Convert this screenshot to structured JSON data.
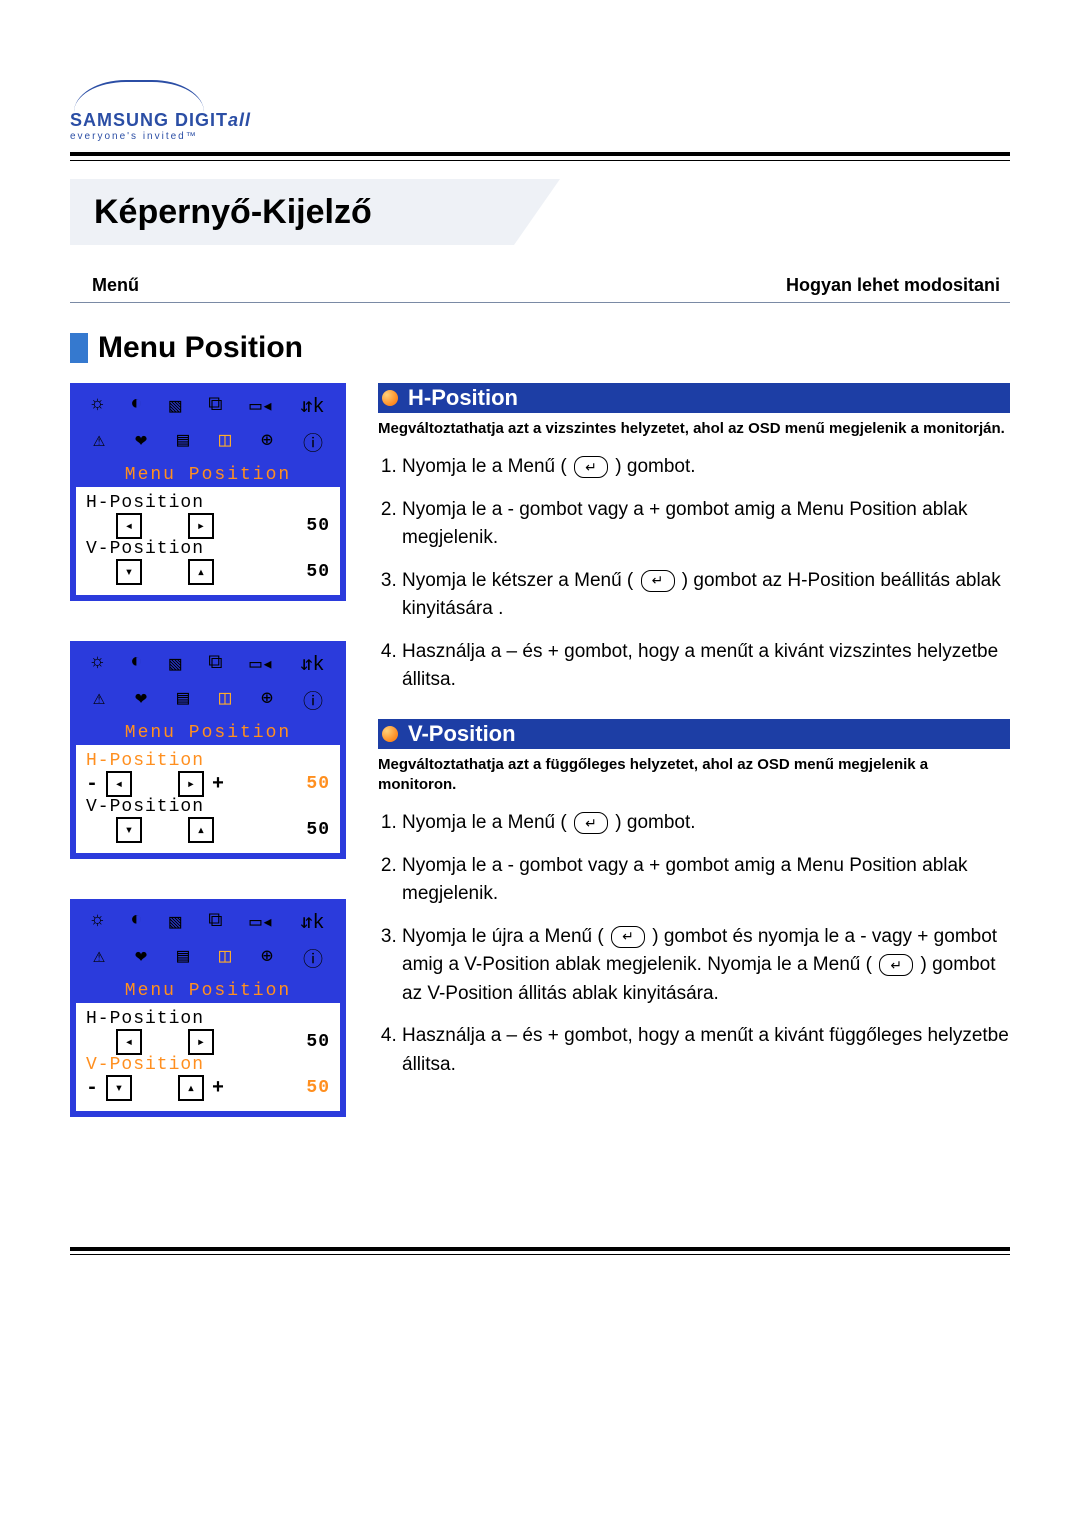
{
  "brand": {
    "main": "SAMSUNG DIGIT",
    "ital": "all",
    "tag": "everyone's invited™"
  },
  "page_title": "Képernyő-Kijelző",
  "subnav": {
    "left": "Menű",
    "right": "Hogyan lehet modositani"
  },
  "section_title": "Menu Position",
  "osd": {
    "title": "Menu Position",
    "h_label": "H-Position",
    "v_label": "V-Position",
    "value50": "50"
  },
  "hpos": {
    "title": "H-Position",
    "desc": "Megváltoztathatja azt a vizszintes helyzetet, ahol az OSD menű megjelenik a monitorján.",
    "steps": {
      "s1a": "Nyomja le a Menű  ( ",
      "s1b": " ) gombot.",
      "s2": "Nyomja le a - gombot vagy a + gombot amig a Menu Position ablak megjelenik.",
      "s3a": "Nyomja le kétszer a Menű ( ",
      "s3b": " ) gombot az H-Position beállitás ablak kinyitására .",
      "s4": "Használja a – és + gombot, hogy a menűt a kivánt vizsz­intes helyzetbe állitsa."
    }
  },
  "vpos": {
    "title": "V-Position",
    "desc": "Megváltoztathatja azt a függőleges helyzetet, ahol az OSD menű megjelenik a monitoron.",
    "steps": {
      "s1a": "Nyomja le a Menű  ( ",
      "s1b": " ) gombot.",
      "s2": "Nyomja le a - gombot vagy a + gombot amig a Menu Po­sition ablak megjelenik.",
      "s3a": "Nyomja le újra a Menű ( ",
      "s3b": " ) gombot és nyomja le a - vagy + gombot amig a V-Position ablak megjelenik. Nyomja le a Menű ( ",
      "s3c": " ) gombot az V-Position állitás ablak kinyitására.",
      "s4": "Használja a – és + gombot, hogy a menűt a kivánt függőleges helyzetbe állitsa."
    }
  }
}
